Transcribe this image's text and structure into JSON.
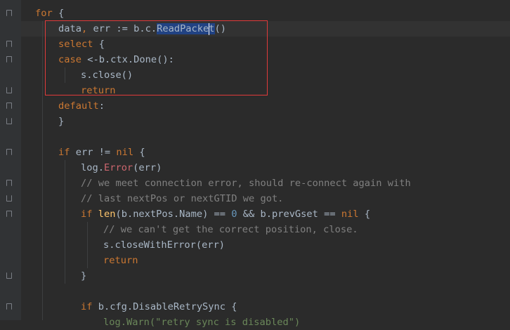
{
  "editor": {
    "lines": [
      {
        "id": "l1",
        "parts": [
          {
            "t": "for",
            "c": "kw"
          },
          {
            "t": " {",
            "c": ""
          }
        ]
      },
      {
        "id": "l2",
        "parts": [
          {
            "t": "data",
            "c": ""
          },
          {
            "t": ", ",
            "c": "kw"
          },
          {
            "t": "err := ",
            "c": ""
          },
          {
            "t": "b.c.",
            "c": ""
          },
          {
            "t": "ReadPacket",
            "c": "sel"
          },
          {
            "t": "()",
            "c": ""
          }
        ]
      },
      {
        "id": "l3",
        "parts": [
          {
            "t": "select",
            "c": "kw"
          },
          {
            "t": " {",
            "c": ""
          }
        ]
      },
      {
        "id": "l4",
        "parts": [
          {
            "t": "case",
            "c": "kw"
          },
          {
            "t": " <-b.ctx.Done():",
            "c": ""
          }
        ]
      },
      {
        "id": "l5",
        "parts": [
          {
            "t": "s.close()",
            "c": ""
          }
        ]
      },
      {
        "id": "l6",
        "parts": [
          {
            "t": "return",
            "c": "kw"
          }
        ]
      },
      {
        "id": "l7",
        "parts": [
          {
            "t": "default",
            "c": "kw"
          },
          {
            "t": ":",
            "c": ""
          }
        ]
      },
      {
        "id": "l8",
        "parts": [
          {
            "t": "}",
            "c": ""
          }
        ]
      },
      {
        "id": "l9",
        "parts": [
          {
            "t": "if",
            "c": "kw"
          },
          {
            "t": " err != ",
            "c": ""
          },
          {
            "t": "nil",
            "c": "kw"
          },
          {
            "t": " {",
            "c": ""
          }
        ]
      },
      {
        "id": "l10",
        "parts": [
          {
            "t": "log.",
            "c": ""
          },
          {
            "t": "Error",
            "c": "err"
          },
          {
            "t": "(err)",
            "c": ""
          }
        ]
      },
      {
        "id": "l11",
        "parts": [
          {
            "t": "// we meet connection error, should re-connect again with",
            "c": "cm"
          }
        ]
      },
      {
        "id": "l12",
        "parts": [
          {
            "t": "// last nextPos or nextGTID we got.",
            "c": "cm"
          }
        ]
      },
      {
        "id": "l13",
        "parts": [
          {
            "t": "if",
            "c": "kw"
          },
          {
            "t": " ",
            "c": ""
          },
          {
            "t": "len",
            "c": "fn"
          },
          {
            "t": "(b.nextPos.Name) == ",
            "c": ""
          },
          {
            "t": "0",
            "c": "num"
          },
          {
            "t": " && b.prevGset == ",
            "c": ""
          },
          {
            "t": "nil",
            "c": "kw"
          },
          {
            "t": " {",
            "c": ""
          }
        ]
      },
      {
        "id": "l14",
        "parts": [
          {
            "t": "// we can't get the correct position, close.",
            "c": "cm"
          }
        ]
      },
      {
        "id": "l15",
        "parts": [
          {
            "t": "s.closeWithError(err)",
            "c": ""
          }
        ]
      },
      {
        "id": "l16",
        "parts": [
          {
            "t": "return",
            "c": "kw"
          }
        ]
      },
      {
        "id": "l17",
        "parts": [
          {
            "t": "}",
            "c": ""
          }
        ]
      },
      {
        "id": "l18",
        "parts": [
          {
            "t": "if",
            "c": "kw"
          },
          {
            "t": " b.cfg.DisableRetrySync {",
            "c": ""
          }
        ]
      },
      {
        "id": "l19",
        "parts": [
          {
            "t": "log.Warn(\"retry sync is disabled\")",
            "c": "str"
          }
        ]
      }
    ]
  },
  "colors": {
    "background": "#2b2b2b",
    "keyword": "#cc7832",
    "comment": "#808080",
    "selection": "#214283",
    "highlight_box": "#e03a3a"
  },
  "icons": [
    "fold-marker-icon"
  ]
}
